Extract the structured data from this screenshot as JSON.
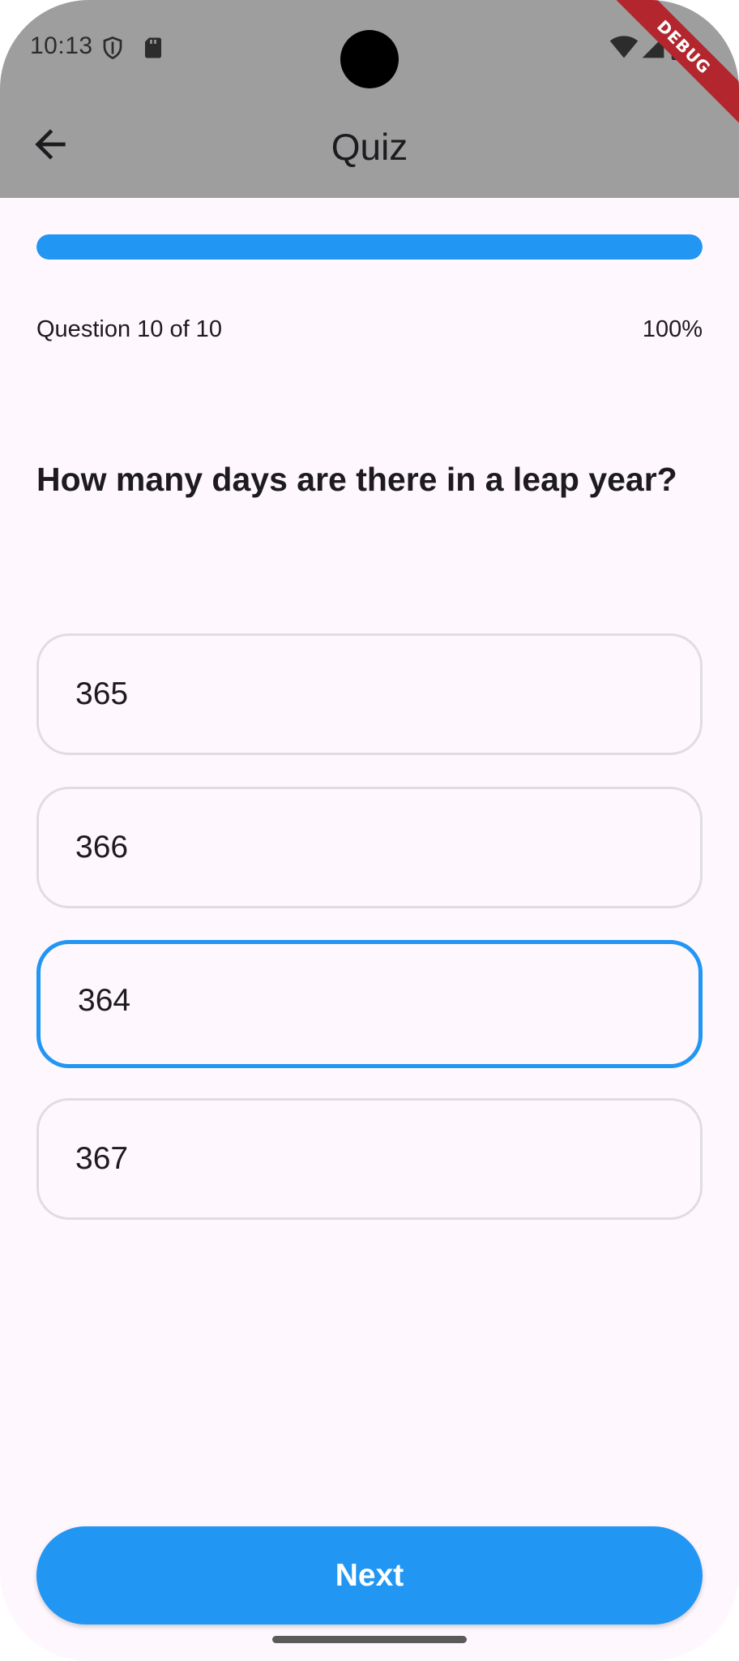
{
  "status_bar": {
    "time": "10:13",
    "icons": [
      "shield-icon",
      "sd-card-icon",
      "wifi-icon",
      "signal-icon",
      "battery-icon"
    ]
  },
  "debug_banner": "DEBUG",
  "app_bar": {
    "title": "Quiz",
    "back_icon": "arrow-back-icon"
  },
  "progress": {
    "label": "Question 10 of 10",
    "percent_text": "100%",
    "fraction": 1.0
  },
  "question": "How many days are there in a leap year?",
  "options": [
    {
      "label": "365",
      "selected": false
    },
    {
      "label": "366",
      "selected": false
    },
    {
      "label": "364",
      "selected": true
    },
    {
      "label": "367",
      "selected": false
    }
  ],
  "next_button": "Next",
  "colors": {
    "accent": "#2196f3",
    "app_bar": "#9e9e9e",
    "background": "#fef7fe",
    "debug_banner": "#b3262e"
  }
}
